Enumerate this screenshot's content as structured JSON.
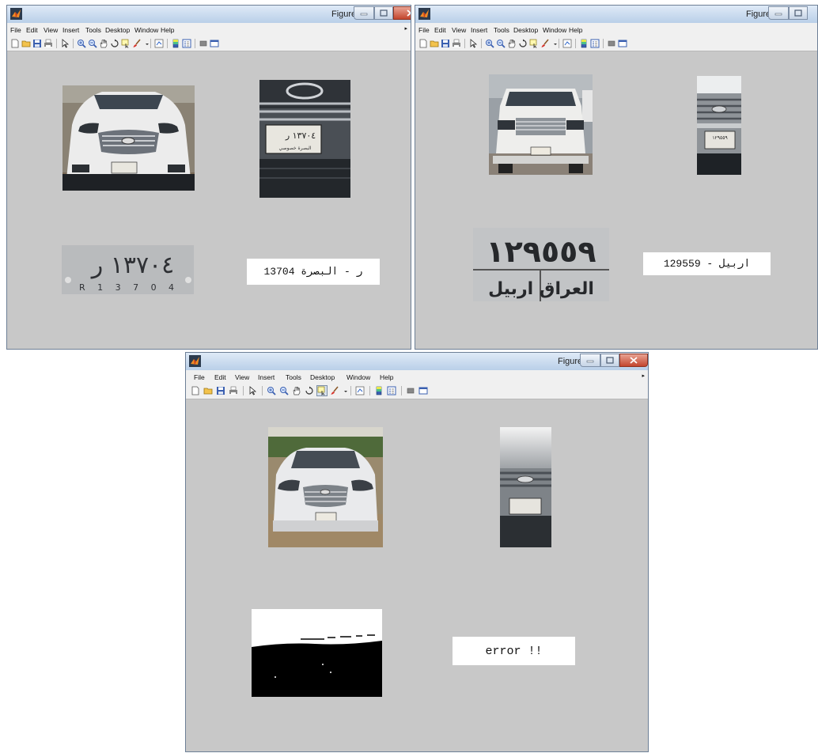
{
  "windows": [
    {
      "title": "Figure 1",
      "menu": [
        "File",
        "Edit",
        "View",
        "Insert",
        "Tools",
        "Desktop",
        "Window",
        "Help"
      ],
      "result_text": "13704 ر - البصرة",
      "plate_text": "١٣٧٠٤ ر",
      "plate_latin": "R 1 3 7 0 4"
    },
    {
      "title": "Figure 3",
      "menu": [
        "File",
        "Edit",
        "View",
        "Insert",
        "Tools",
        "Desktop",
        "Window",
        "Help"
      ],
      "result_text": "129559 - اربيل",
      "plate_text": "١٢٩٥٥٩",
      "plate_city": "العراق   اربيل"
    },
    {
      "title": "Figure 1",
      "menu": [
        "File",
        "Edit",
        "View",
        "Insert",
        "Tools",
        "Desktop",
        "Window",
        "Help"
      ],
      "result_text": "error !!"
    }
  ],
  "icons": {
    "toolbar": [
      "new-figure",
      "open-file",
      "save",
      "print",
      "edit-plot",
      "zoom-in",
      "zoom-out",
      "pan",
      "rotate-3d",
      "data-cursor",
      "brush",
      "link",
      "colorbar",
      "legend",
      "hide-tools",
      "show-tools"
    ],
    "controls": [
      "minimize",
      "maximize",
      "close"
    ]
  },
  "colors": {
    "canvas": "#c8c8c8",
    "titlebar": "#c9d9ee",
    "close_button": "#c3452d"
  }
}
